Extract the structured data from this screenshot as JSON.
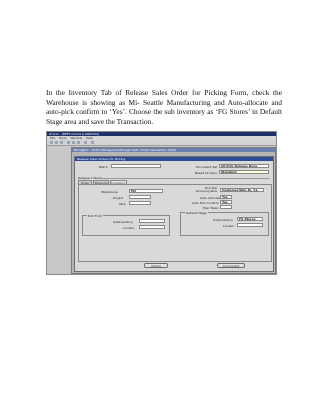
{
  "paragraph": "In the Inventory Tab of Release Sales Order for Picking Form, check the Warehouse is showing as Mi- Seattle Manufacturing and Auto-allocate and auto-pick confirm to ‘Yes’. Choose the sub inventory as ‘FG Stores’ in Default Stage area and save the Transaction.",
  "screenshot": {
    "app_title": "Oracle - [BEFS Oracle (LAB0000)]",
    "menu": [
      "File",
      "Tools",
      "Window",
      "Help"
    ],
    "inner_title": "Navigator - Order Management/Super User, Vision Operations (USA)",
    "dialog_title": "Release Sales Orders for Picking",
    "batch_label": "Batch",
    "document_set_label": "Document Set",
    "document_set_value": "All Pick Release Docu",
    "based_on_rule_label": "Based On Rule",
    "based_on_rule_value": "Standard",
    "release_criteria_label": "Release Criteria",
    "tabs": [
      "Order",
      "Shipping",
      "Inventory"
    ],
    "warehouse_label": "Warehouse",
    "warehouse_value": "M1",
    "project_label": "Project",
    "task_label": "Task",
    "pick_slip_label": "Pick Slip Grouping Rule",
    "pick_slip_value": "Customer,Ship To, Ca",
    "auto_allocate_label": "Auto Allocate",
    "auto_allocate_value": "Yes",
    "auto_pick_confirm_label": "Auto Pick Confirm",
    "auto_pick_confirm_value": "Yes",
    "plan_tasks_label": "Plan Tasks",
    "pick_from_label": "Pick From",
    "default_stage_label": "Default Stage",
    "subinventory_label": "Subinventory",
    "subinventory_value": "FG Stores",
    "locator_label": "Locator",
    "online_button": "Online",
    "concurrent_button": "Concurrent"
  }
}
